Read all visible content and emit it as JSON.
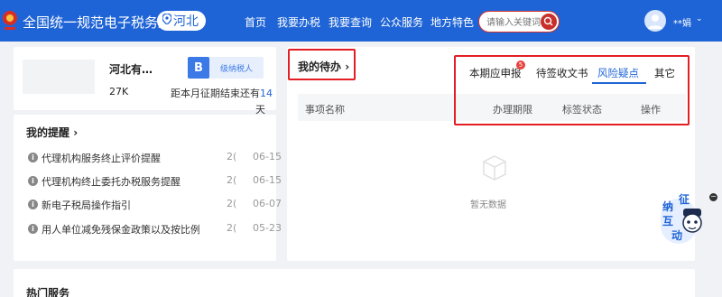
{
  "header": {
    "site_title": "全国统一规范电子税务局",
    "region": "河北",
    "nav": [
      "首页",
      "我要办税",
      "我要查询",
      "公众服务",
      "地方特色"
    ],
    "search_placeholder": "请输入关键词",
    "username": "**娟",
    "brand_color": "#1f64d6"
  },
  "profile": {
    "company": "河北有…",
    "badge_letter": "B",
    "badge_text": "级纳税人",
    "revenue": "27K",
    "deadline_prefix": "距本月征期结束还有",
    "deadline_days": "14",
    "deadline_unit": "天"
  },
  "reminders": {
    "title": "我的提醒",
    "items": [
      {
        "text": "代理机构服务终止评价提醒",
        "year": "2(",
        "date": "06-15"
      },
      {
        "text": "代理机构终止委托办税服务提醒",
        "year": "2(",
        "date": "06-15"
      },
      {
        "text": "新电子税局操作指引",
        "year": "2(",
        "date": "06-07"
      },
      {
        "text": "用人单位减免残保金政策以及按比例…",
        "year": "2(",
        "date": "05-23"
      }
    ]
  },
  "todo": {
    "title": "我的待办",
    "tabs": [
      "本期应申报",
      "待签收文书",
      "风险疑点",
      "其它"
    ],
    "active_tab": 2,
    "tab_badge": "5",
    "columns": [
      "事项名称",
      "办理期限",
      "标签状态",
      "操作"
    ],
    "empty_text": "暂无数据"
  },
  "hot_services": {
    "title": "热门服务"
  },
  "helper": {
    "chars": [
      "纳",
      "征",
      "互",
      "动"
    ],
    "minimize": "−"
  }
}
